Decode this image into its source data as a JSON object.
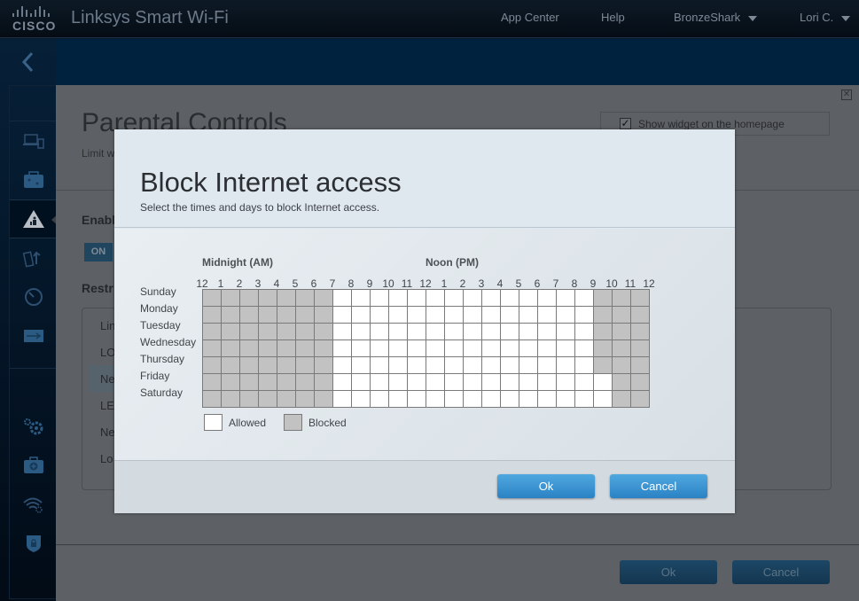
{
  "app": {
    "logo_text": "CISCO",
    "brand": "Linksys Smart Wi-Fi"
  },
  "topnav": {
    "app_center": "App Center",
    "help": "Help",
    "router_name": "BronzeShark",
    "user_name": "Lori C."
  },
  "sidebar": {
    "back_icon": "chevron-left-icon",
    "items": [
      {
        "icon": "devices-icon",
        "name": "device-list"
      },
      {
        "icon": "guest-access-icon",
        "name": "guest-access"
      },
      {
        "icon": "parental-controls-icon",
        "name": "parental-controls",
        "active": true
      },
      {
        "icon": "media-prioritization-icon",
        "name": "media-prioritization"
      },
      {
        "icon": "speed-test-icon",
        "name": "speed-test"
      },
      {
        "icon": "usb-storage-icon",
        "name": "external-storage"
      },
      {
        "icon": "connectivity-gear-icon",
        "name": "connectivity"
      },
      {
        "icon": "troubleshooting-icon",
        "name": "troubleshooting"
      },
      {
        "icon": "wireless-settings-icon",
        "name": "wireless"
      },
      {
        "icon": "security-lock-icon",
        "name": "security"
      }
    ]
  },
  "background_panel": {
    "title": "Parental Controls",
    "subtitle": "Limit w",
    "show_widget_label": "Show widget on the homepage",
    "show_widget_checked": true,
    "enable_label": "Enabl",
    "on_label": "ON",
    "restrict_label": "Restr",
    "device_rows": [
      "Lin",
      "LO",
      "Ne",
      "LE",
      "Ne",
      "Lo"
    ],
    "selected_row": 2,
    "ok_label": "Ok",
    "cancel_label": "Cancel"
  },
  "modal": {
    "title": "Block Internet access",
    "subtitle": "Select the times and days to block Internet access.",
    "am_label": "Midnight (AM)",
    "pm_label": "Noon (PM)",
    "hour_labels": [
      "12",
      "1",
      "2",
      "3",
      "4",
      "5",
      "6",
      "7",
      "8",
      "9",
      "10",
      "11",
      "12",
      "1",
      "2",
      "3",
      "4",
      "5",
      "6",
      "7",
      "8",
      "9",
      "10",
      "11",
      "12"
    ],
    "days": [
      "Sunday",
      "Monday",
      "Tuesday",
      "Wednesday",
      "Thursday",
      "Friday",
      "Saturday"
    ],
    "schedule": {
      "Sunday": {
        "blocked_hours": [
          0,
          1,
          2,
          3,
          4,
          5,
          6,
          21,
          22,
          23
        ]
      },
      "Monday": {
        "blocked_hours": [
          0,
          1,
          2,
          3,
          4,
          5,
          6,
          21,
          22,
          23
        ]
      },
      "Tuesday": {
        "blocked_hours": [
          0,
          1,
          2,
          3,
          4,
          5,
          6,
          21,
          22,
          23
        ]
      },
      "Wednesday": {
        "blocked_hours": [
          0,
          1,
          2,
          3,
          4,
          5,
          6,
          21,
          22,
          23
        ]
      },
      "Thursday": {
        "blocked_hours": [
          0,
          1,
          2,
          3,
          4,
          5,
          6,
          21,
          22,
          23
        ]
      },
      "Friday": {
        "blocked_hours": [
          0,
          1,
          2,
          3,
          4,
          5,
          6,
          22,
          23
        ]
      },
      "Saturday": {
        "blocked_hours": [
          0,
          1,
          2,
          3,
          4,
          5,
          6,
          22,
          23
        ]
      }
    },
    "legend": {
      "allowed": "Allowed",
      "blocked": "Blocked"
    },
    "colors": {
      "allowed": "#ffffff",
      "blocked": "#c2c2c2",
      "button": "#3a93d2"
    },
    "ok_label": "Ok",
    "cancel_label": "Cancel"
  }
}
